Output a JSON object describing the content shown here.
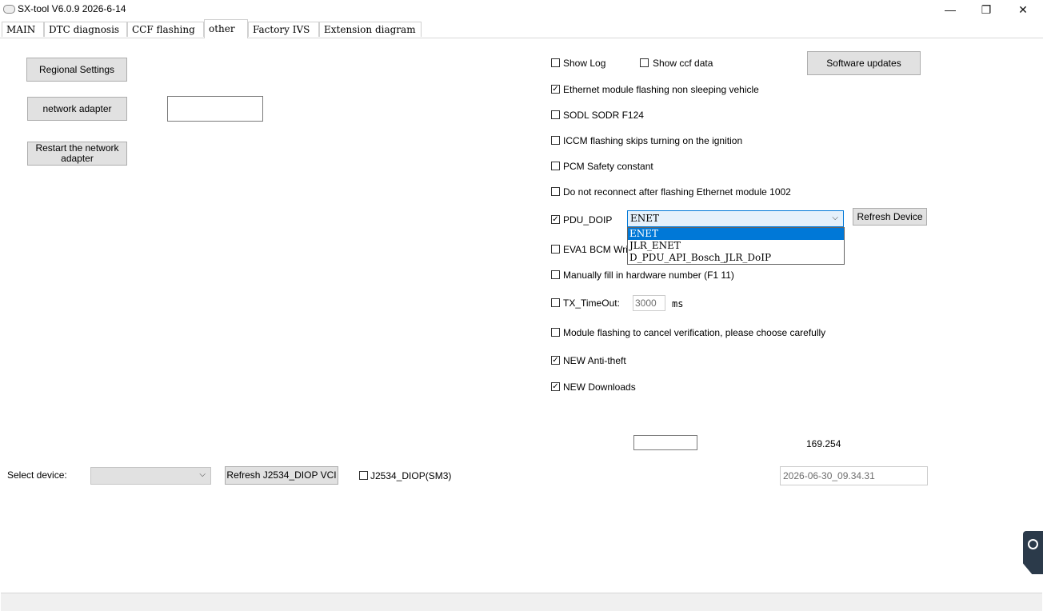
{
  "window": {
    "title": "SX-tool V6.0.9  2026-6-14",
    "minimize_glyph": "—",
    "restore_glyph": "❐",
    "close_glyph": "✕"
  },
  "tabs": [
    {
      "label": "MAIN"
    },
    {
      "label": "DTC diagnosis"
    },
    {
      "label": "CCF flashing"
    },
    {
      "label": "other"
    },
    {
      "label": "Factory IVS"
    },
    {
      "label": "Extension diagram"
    }
  ],
  "active_tab": "other",
  "left_panel": {
    "regional_settings": "Regional Settings",
    "network_adapter": "network adapter",
    "network_adapter_value": "",
    "restart_line1": "Restart the network",
    "restart_line2": "adapter"
  },
  "options": {
    "show_log": {
      "label": "Show Log",
      "checked": false
    },
    "show_ccf": {
      "label": "Show ccf data",
      "checked": false
    },
    "software_updates": "Software updates",
    "ethernet_flash": {
      "label": "Ethernet module flashing non sleeping vehicle",
      "checked": true
    },
    "sodl": {
      "label": "SODL SODR F124",
      "checked": false
    },
    "iccm": {
      "label": "ICCM flashing skips turning on the ignition",
      "checked": false
    },
    "pcm": {
      "label": "PCM Safety constant",
      "checked": false
    },
    "no_reconnect": {
      "label": "Do not reconnect after flashing Ethernet module 1002",
      "checked": false
    },
    "pdu_doip": {
      "label": "PDU_DOIP",
      "checked": true
    },
    "eva1": {
      "label": "EVA1 BCM Write",
      "checked": false
    },
    "manual_hw": {
      "label": "Manually fill in hardware number (F1 11)",
      "checked": false
    },
    "tx_timeout": {
      "label": "TX_TimeOut:",
      "checked": false,
      "value": "3000",
      "unit": "ms"
    },
    "cancel_verify": {
      "label": "Module flashing to cancel verification, please choose carefully",
      "checked": false
    },
    "anti_theft": {
      "label": "NEW Anti-theft",
      "checked": true
    },
    "downloads": {
      "label": "NEW Downloads",
      "checked": true
    }
  },
  "pdu_combo": {
    "selected": "ENET",
    "options": [
      "ENET",
      "JLR_ENET",
      "D_PDU_API_Bosch_JLR_DoIP"
    ],
    "arrow_glyph": "⌵"
  },
  "refresh_device": "Refresh Device",
  "ip_field_value": "",
  "ip_suffix": "169.254",
  "bottom": {
    "select_device_label": "Select device:",
    "select_device_value": "",
    "refresh_j2534": "Refresh J2534_DIOP VCI",
    "j2534_sm3": {
      "label": "J2534_DIOP(SM3)",
      "checked": false
    },
    "timestamp": "2026-06-30_09.34.31"
  },
  "check_glyph": "✓"
}
